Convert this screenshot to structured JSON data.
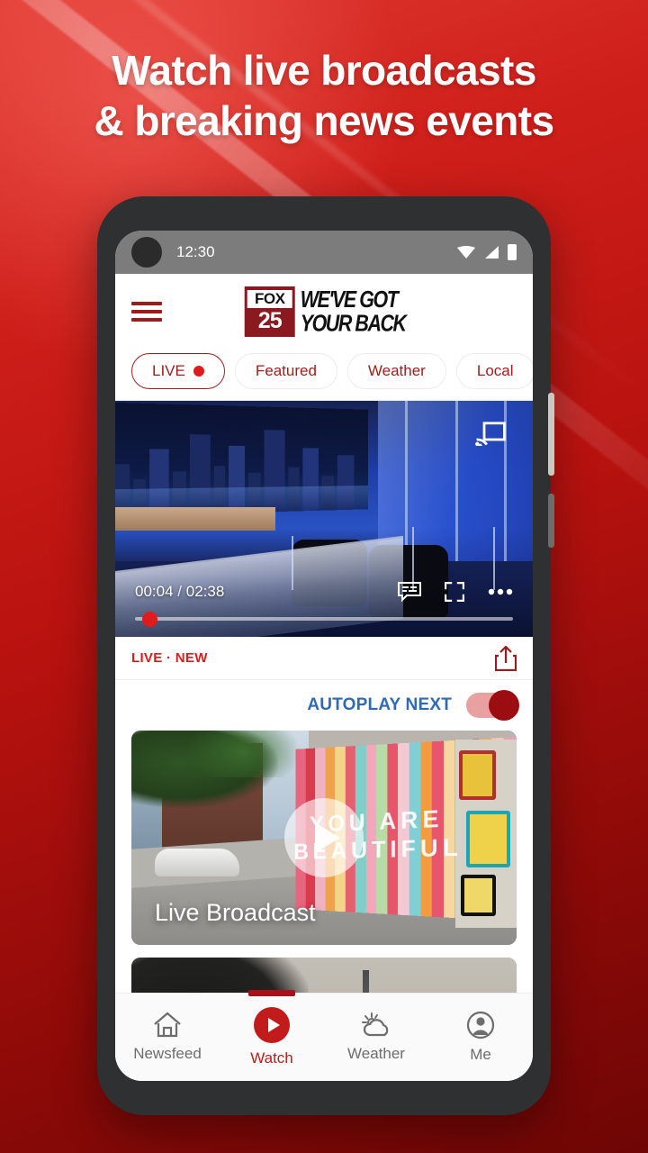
{
  "promo": {
    "headline_line1": "Watch live broadcasts",
    "headline_line2": "& breaking news events",
    "background_color": "#b8120f"
  },
  "phone": {
    "status_bar": {
      "time": "12:30",
      "icons": [
        "wifi-icon",
        "signal-icon",
        "battery-icon"
      ]
    }
  },
  "app": {
    "header": {
      "menu_icon": "hamburger-menu-icon",
      "logo": {
        "fox_text": "FOX",
        "channel_number": "25",
        "tagline_line1": "WE'VE GOT",
        "tagline_line2": "YOUR BACK",
        "brand_color": "#8b1a20"
      }
    },
    "tabs": [
      {
        "label": "LIVE",
        "active": true,
        "has_dot": true
      },
      {
        "label": "Featured",
        "active": false,
        "has_dot": false
      },
      {
        "label": "Weather",
        "active": false,
        "has_dot": false
      },
      {
        "label": "Local",
        "active": false,
        "has_dot": false
      },
      {
        "label": "",
        "active": false,
        "has_dot": false
      }
    ],
    "player": {
      "current_time": "00:04",
      "separator": "/",
      "duration": "02:38",
      "cast_icon": "cast-icon",
      "captions_icon": "closed-captions-icon",
      "fullscreen_icon": "fullscreen-icon",
      "more_icon": "more-options-icon",
      "progress_percent": 3
    },
    "meta": {
      "badge": "LIVE · NEW",
      "badge_color": "#e01b1b",
      "share_icon": "share-icon"
    },
    "autoplay": {
      "label": "AUTOPLAY NEXT",
      "label_color": "#2f6bb5",
      "enabled": true
    },
    "cards": [
      {
        "title": "Live Broadcast",
        "mural_text": "YOU ARE BEAUTIFUL",
        "play_icon": "play-button-icon"
      },
      {
        "title": "",
        "play_icon": "play-button-icon"
      }
    ],
    "bottom_nav": [
      {
        "label": "Newsfeed",
        "icon": "home-icon",
        "active": false
      },
      {
        "label": "Watch",
        "icon": "play-circle-icon",
        "active": true
      },
      {
        "label": "Weather",
        "icon": "sun-cloud-icon",
        "active": false
      },
      {
        "label": "Me",
        "icon": "account-circle-icon",
        "active": false
      }
    ]
  }
}
